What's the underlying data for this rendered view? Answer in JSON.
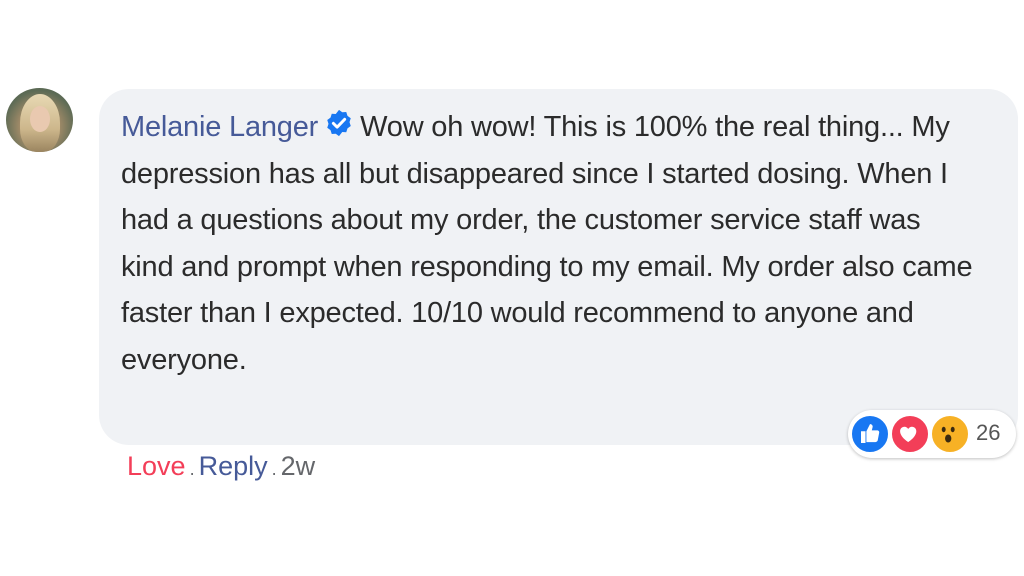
{
  "comment": {
    "author": "Melanie Langer",
    "text": "Wow oh wow! This is 100% the real thing... My depression has all but disappeared since I started dosing. When I had a questions about my order, the customer service staff was kind and prompt when responding to my email. My order also came faster than I expected. 10/10 would recommend to anyone and everyone.",
    "verified_icon": "verified-badge-icon",
    "reactions": {
      "icons": [
        "like-icon",
        "love-icon",
        "wow-icon"
      ],
      "count": "26"
    },
    "actions": {
      "love_label": "Love",
      "reply_label": "Reply",
      "separator": ".",
      "timestamp": "2w"
    }
  },
  "colors": {
    "author": "#465a98",
    "bubble_bg": "#f0f2f5",
    "love": "#f33e58",
    "like": "#1877f2",
    "wow": "#f7b125"
  }
}
